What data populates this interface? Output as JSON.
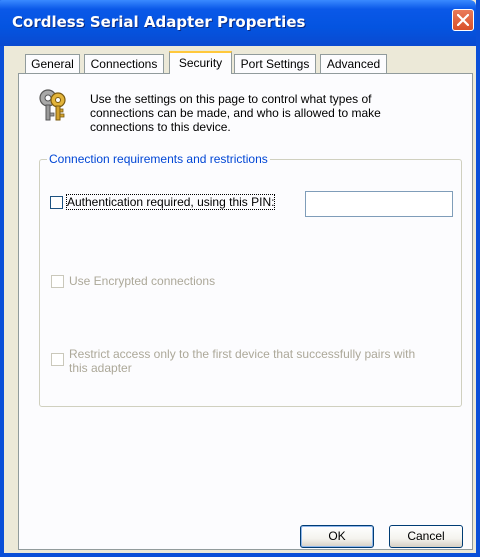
{
  "window": {
    "title": "Cordless Serial Adapter Properties"
  },
  "tabs": [
    {
      "label": "General"
    },
    {
      "label": "Connections"
    },
    {
      "label": "Security",
      "active": true
    },
    {
      "label": "Port Settings"
    },
    {
      "label": "Advanced"
    }
  ],
  "security": {
    "icon": "keys-icon",
    "intro": "Use the settings on this page to control what types of connections can be made, and who is allowed to make connections to this device.",
    "group_title": "Connection requirements and restrictions",
    "options": {
      "auth": {
        "label": "Authentication required, using this PIN:",
        "checked": false,
        "enabled": true
      },
      "encrypt": {
        "label": "Use Encrypted connections",
        "checked": false,
        "enabled": false
      },
      "restrict": {
        "label": "Restrict access only to the first device that successfully pairs with this adapter",
        "checked": false,
        "enabled": false
      }
    },
    "pin_value": ""
  },
  "buttons": {
    "ok": "OK",
    "cancel": "Cancel"
  },
  "colors": {
    "titlebar": "#0454e0",
    "accent": "#0046d5",
    "active_tab_highlight": "#ffc83c",
    "close_button": "#d9502a"
  }
}
